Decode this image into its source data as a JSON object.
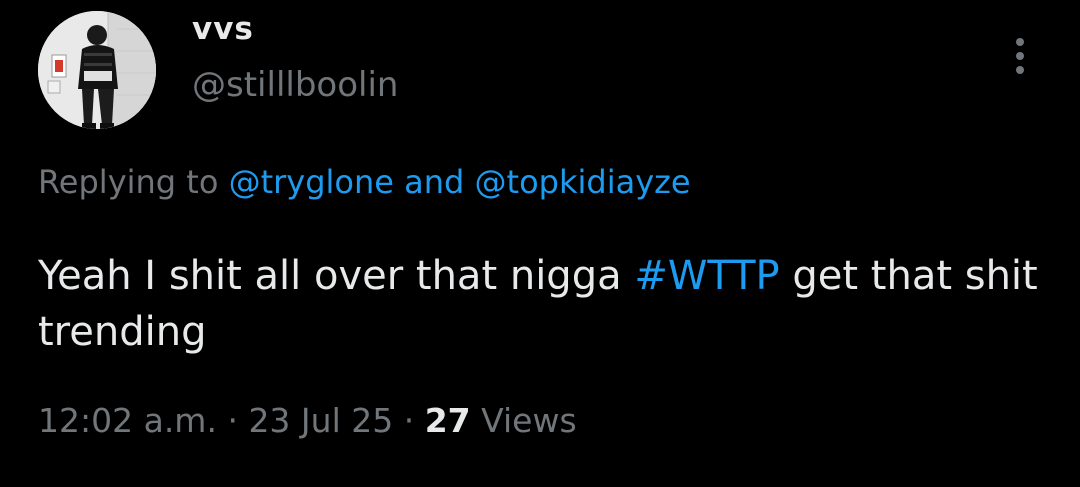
{
  "user": {
    "display_name": "vvs",
    "handle": "@stilllboolin",
    "avatar_icon": "profile-photo"
  },
  "reply": {
    "prefix": "Replying to ",
    "mention_1": "@tryglone",
    "conjunction": " and ",
    "mention_2": "@topkidiayze"
  },
  "tweet": {
    "text_before": "Yeah I shit all over that nigga ",
    "hashtag": "#WTTP",
    "text_after": " get that shit trending"
  },
  "meta": {
    "time": "12:02 a.m.",
    "separator_1": " · ",
    "date": "23 Jul 25",
    "separator_2": " · ",
    "views_count": "27",
    "views_label": " Views"
  },
  "menu": {
    "icon": "more-vertical-icon"
  },
  "colors": {
    "background": "#000000",
    "text_primary": "#e7e9ea",
    "text_secondary": "#71767b",
    "accent": "#1d9bf0"
  }
}
